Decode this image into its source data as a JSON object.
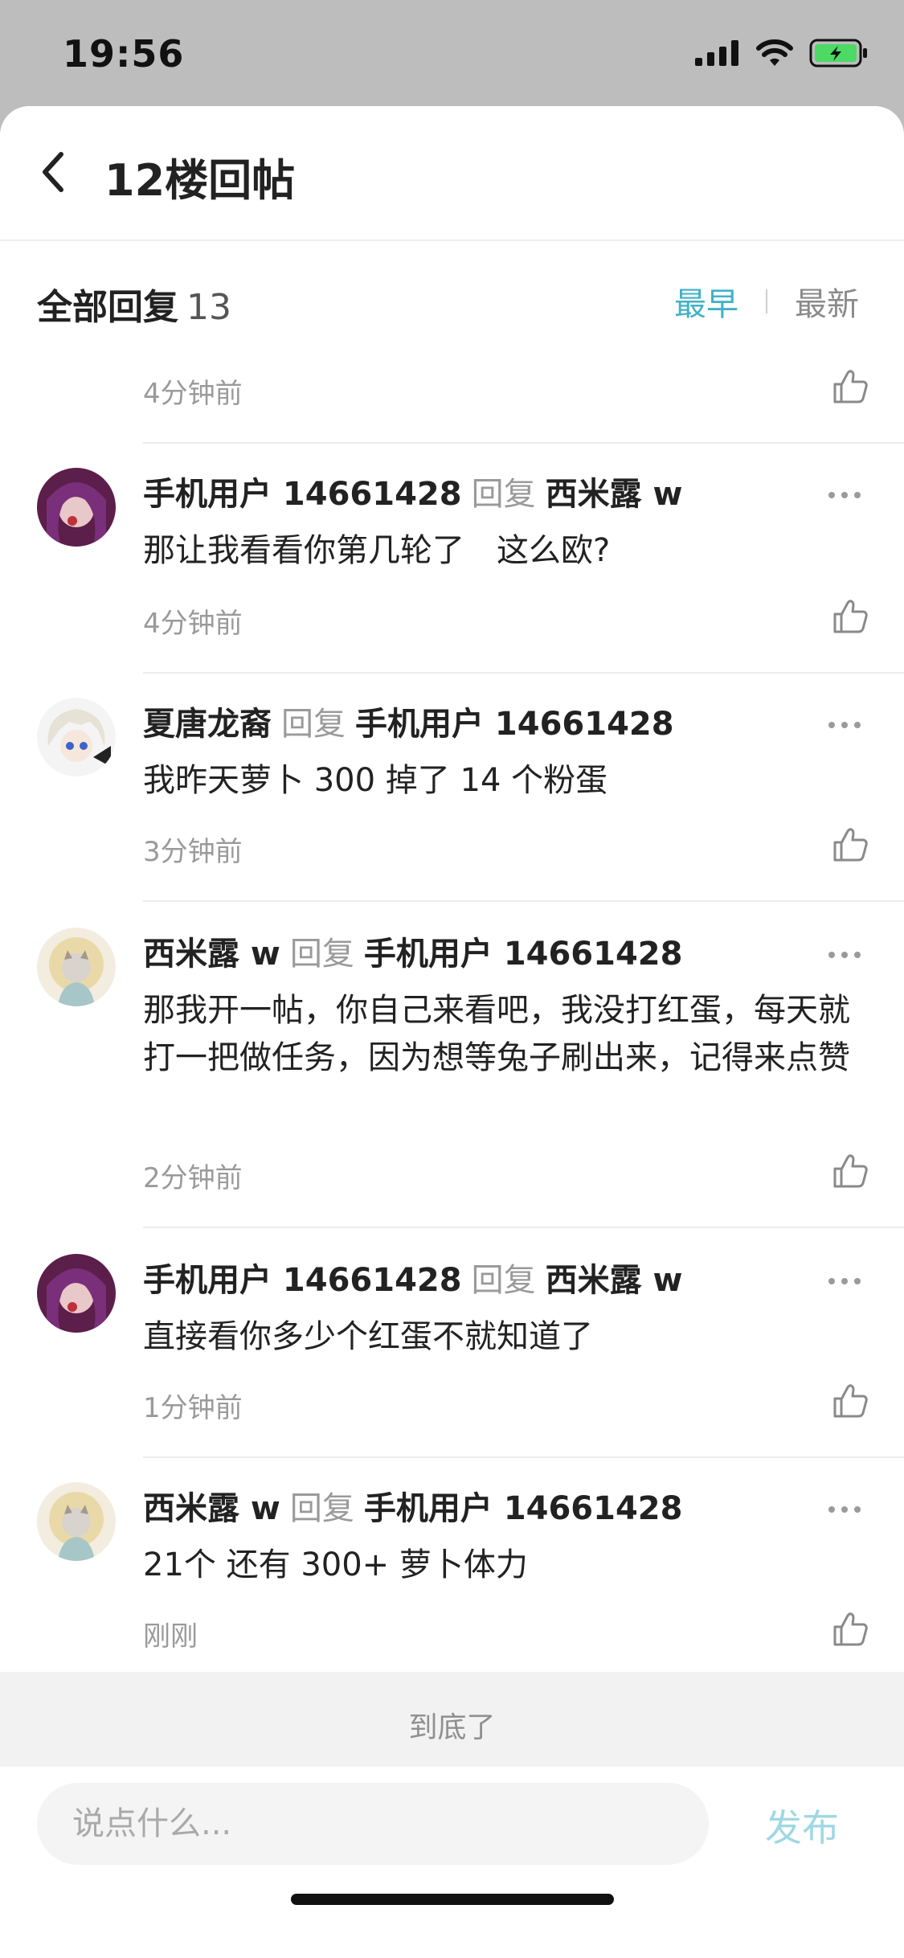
{
  "status_bar": {
    "time": "19:56",
    "battery_color": "#4cd964"
  },
  "header": {
    "title": "12楼回帖"
  },
  "sort_bar": {
    "all_label": "全部回复",
    "count": "13",
    "sort_earliest": "最早",
    "sort_latest": "最新",
    "active_color": "#3fb2c5"
  },
  "first_item": {
    "time": "4分钟前"
  },
  "replies": [
    {
      "author": "手机用户 14661428",
      "reply_word": "回复",
      "target": "西米露 w",
      "text": "那让我看看你第几轮了　这么欧?",
      "time": "4分钟前"
    },
    {
      "author": "夏唐龙裔",
      "reply_word": "回复",
      "target": "手机用户 14661428",
      "text": "我昨天萝卜 300 掉了 14 个粉蛋",
      "time": "3分钟前"
    },
    {
      "author": "西米露 w",
      "reply_word": "回复",
      "target": "手机用户 14661428",
      "text": "那我开一帖，你自己来看吧，我没打红蛋，每天就打一把做任务，因为想等兔子刷出来，记得来点赞",
      "time": "2分钟前"
    },
    {
      "author": "手机用户 14661428",
      "reply_word": "回复",
      "target": "西米露 w",
      "text": "直接看你多少个红蛋不就知道了",
      "time": "1分钟前"
    },
    {
      "author": "西米露 w",
      "reply_word": "回复",
      "target": "手机用户 14661428",
      "text": "21个 还有 300+ 萝卜体力",
      "time": "刚刚"
    }
  ],
  "footer": {
    "end_label": "到底了"
  },
  "composer": {
    "placeholder": "说点什么...",
    "publish_label": "发布",
    "publish_color": "#9fd8e2"
  }
}
